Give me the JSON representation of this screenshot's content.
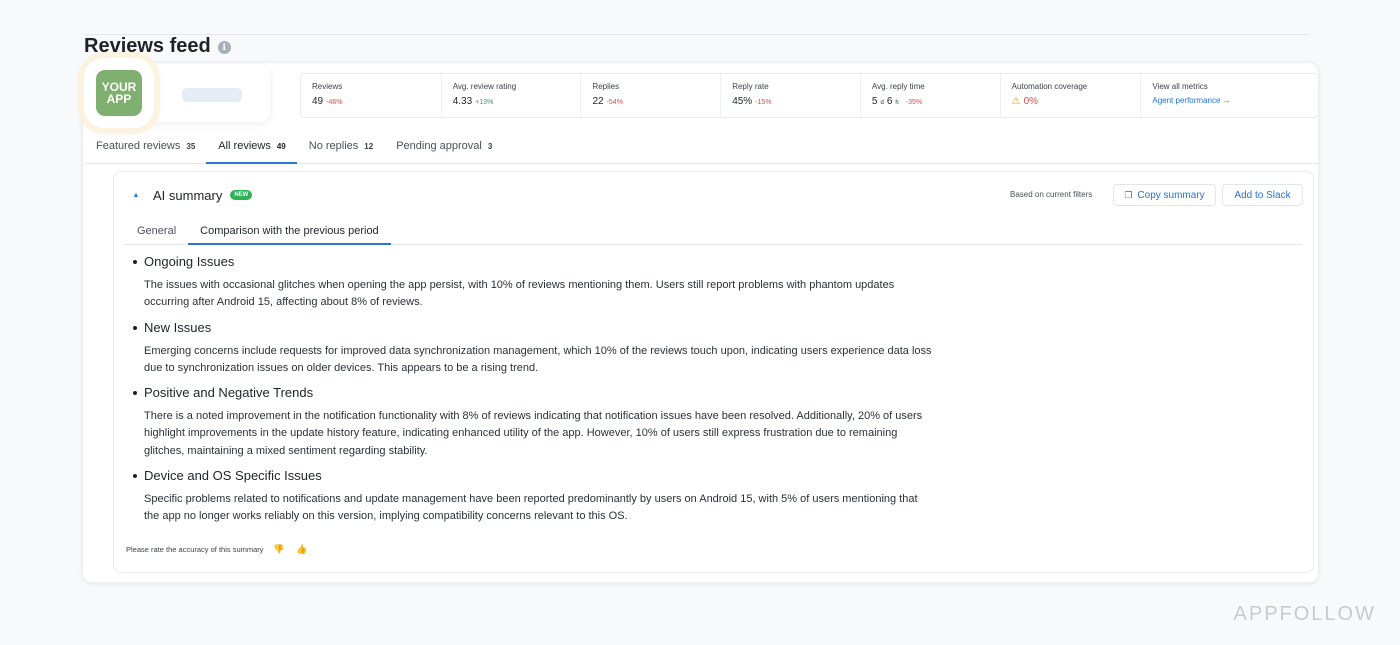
{
  "page": {
    "title": "Reviews feed",
    "watermark": "APPFOLLOW"
  },
  "app": {
    "icon_line1": "YOUR",
    "icon_line2": "APP"
  },
  "metrics": [
    {
      "label": "Reviews",
      "value": "49",
      "delta": "-46%",
      "trend": "neg"
    },
    {
      "label": "Avg. review rating",
      "value": "4.33",
      "delta": "+13%",
      "trend": "pos"
    },
    {
      "label": "Replies",
      "value": "22",
      "delta": "-54%",
      "trend": "neg"
    },
    {
      "label": "Reply rate",
      "value": "45%",
      "delta": "-15%",
      "trend": "neg"
    },
    {
      "label": "Avg. reply time",
      "value_d": "5",
      "unit_d": "d",
      "value_h": "6",
      "unit_h": "h",
      "delta": "-35%",
      "trend": "neg"
    },
    {
      "label": "Automation coverage",
      "value": "0%",
      "trend": "neg"
    },
    {
      "label": "View all metrics",
      "link": "Agent performance →"
    }
  ],
  "tabs": [
    {
      "label": "Featured reviews",
      "count": "35"
    },
    {
      "label": "All reviews",
      "count": "49"
    },
    {
      "label": "No replies",
      "count": "12"
    },
    {
      "label": "Pending approval",
      "count": "3"
    }
  ],
  "summary": {
    "title": "AI summary",
    "badge": "NEW",
    "filters_note": "Based on current filters",
    "copy_label": "Copy summary",
    "slack_label": "Add to Slack",
    "subtabs": [
      "General",
      "Comparison with the previous period"
    ],
    "sections": [
      {
        "title": "Ongoing Issues",
        "text": "The issues with occasional glitches when opening the app persist, with 10% of reviews mentioning them. Users still report problems with phantom updates occurring after Android 15, affecting about 8% of reviews."
      },
      {
        "title": "New Issues",
        "text": "Emerging concerns include requests for improved data synchronization management, which 10% of the reviews touch upon, indicating users experience data loss due to synchronization issues on older devices. This appears to be a rising trend."
      },
      {
        "title": "Positive and Negative Trends",
        "text": "There is a noted improvement in the notification functionality with 8% of reviews indicating that notification issues have been resolved. Additionally, 20% of users highlight improvements in the update history feature, indicating enhanced utility of the app. However, 10% of users still express frustration due to remaining glitches, maintaining a mixed sentiment regarding stability."
      },
      {
        "title": "Device and OS Specific Issues",
        "text": "Specific problems related to notifications and update management have been reported predominantly by users on Android 15, with 5% of users mentioning that the app no longer works reliably on this version, implying compatibility concerns relevant to this OS."
      }
    ],
    "rate_prompt": "Please rate the accuracy of this summary"
  },
  "colors": {
    "accent": "#2a74d8",
    "negative": "#e04848",
    "positive": "#2fa05c",
    "new_badge": "#2fb155",
    "app_icon": "#7fb06f"
  }
}
